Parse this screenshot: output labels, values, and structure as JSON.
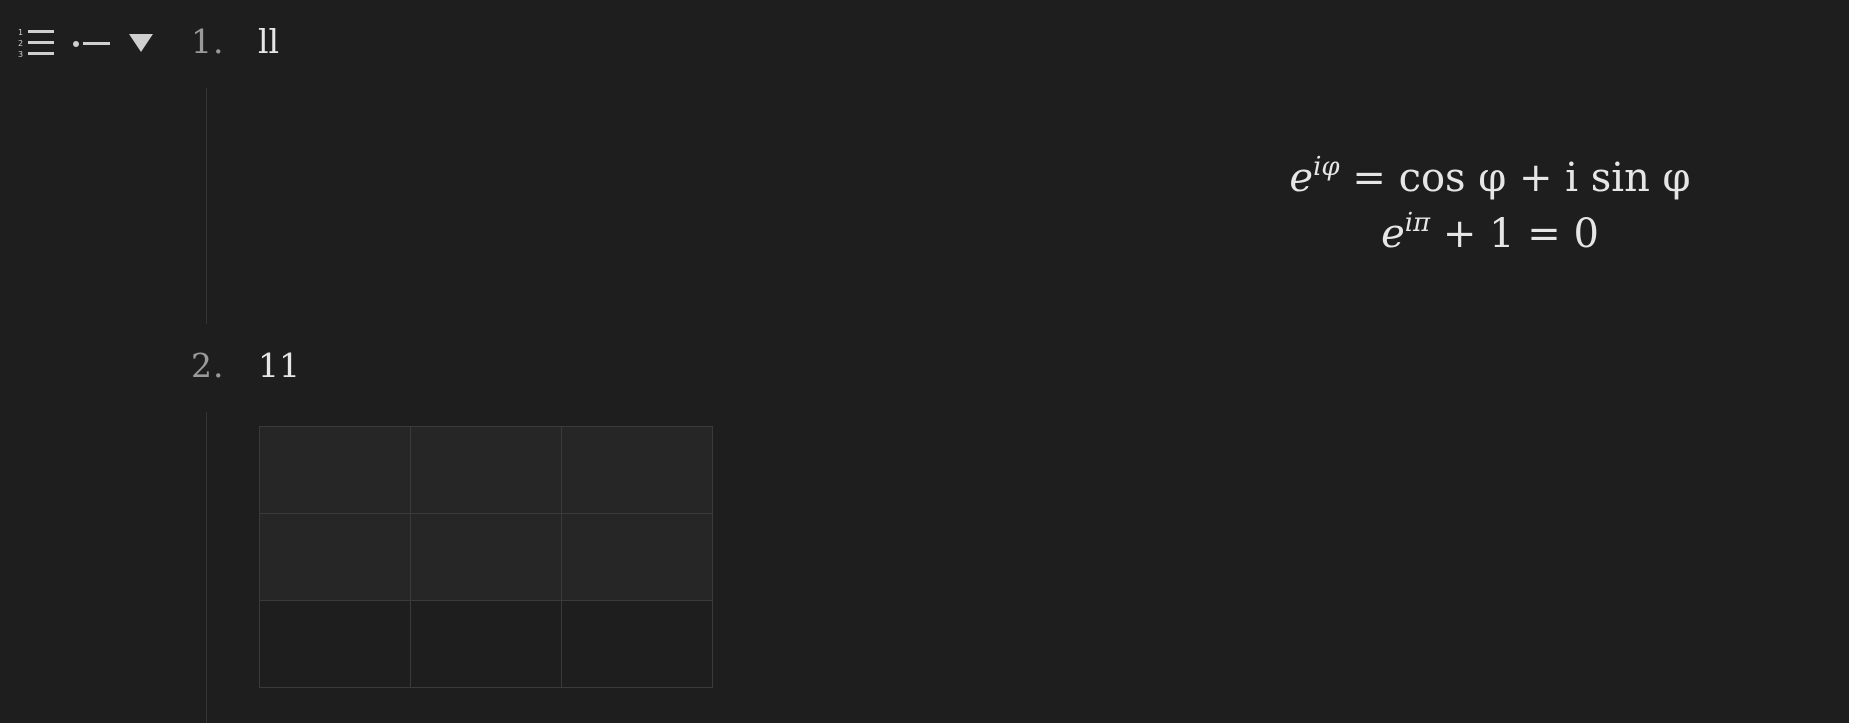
{
  "toolbar": {
    "ordered_list_icon": "ordered-list-icon",
    "bullet_list_icon": "bullet-list-icon",
    "toggle_icon": "triangle-down-icon"
  },
  "list": {
    "items": [
      {
        "number": "1.",
        "text": "ll"
      },
      {
        "number": "2.",
        "text": "11"
      }
    ]
  },
  "math": {
    "line1": {
      "base": "e",
      "exp": "iφ",
      "rest": " = cos φ + i sin φ"
    },
    "line2": {
      "base": "e",
      "exp": "iπ",
      "rest": " + 1 = 0"
    }
  },
  "table": {
    "rows": [
      [
        "",
        "",
        ""
      ],
      [
        "",
        "",
        ""
      ],
      [
        "",
        "",
        ""
      ]
    ]
  },
  "colors": {
    "background": "#1e1e1e",
    "text": "#e6e6e6",
    "muted": "#9a9a9a",
    "table_border": "#3a3a3a"
  }
}
